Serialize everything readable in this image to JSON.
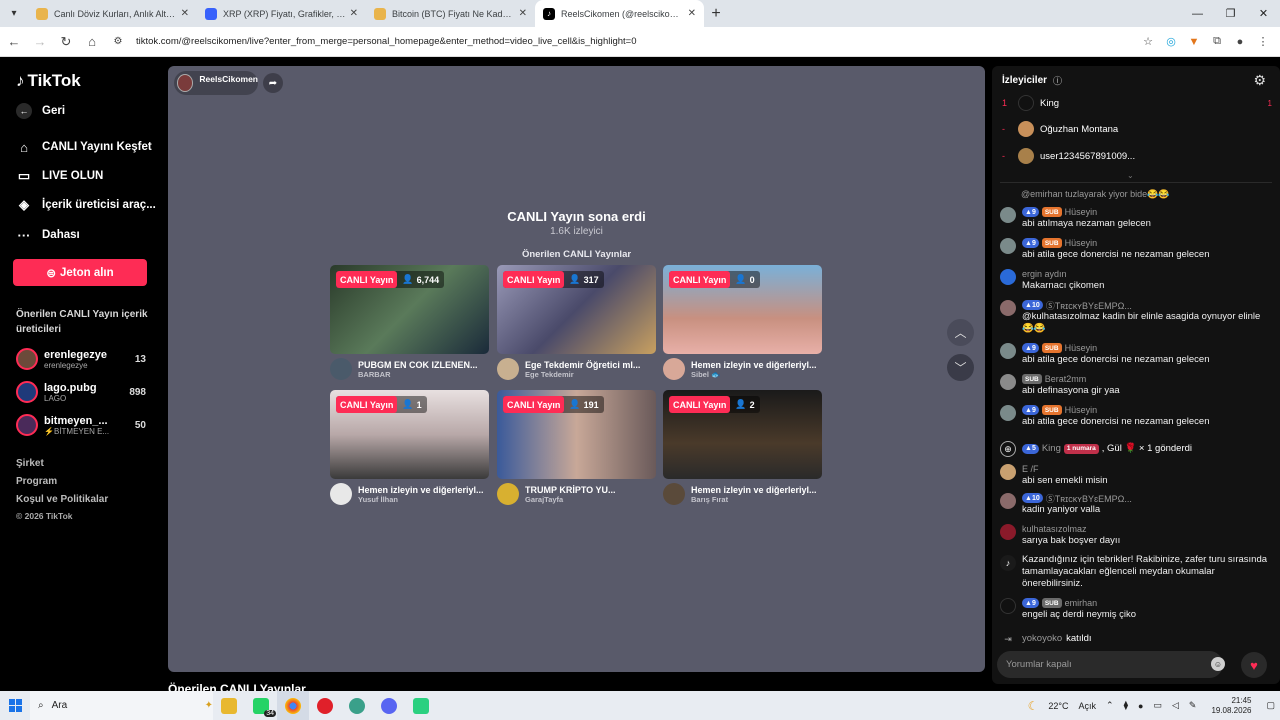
{
  "browser": {
    "tabs": [
      {
        "title": "Canlı Döviz Kurları, Anlık Altın F",
        "icon_color": "#e9b44c"
      },
      {
        "title": "XRP (XRP) Fiyatı, Grafikler, Piyas",
        "icon_color": "#3861fb"
      },
      {
        "title": "Bitcoin (BTC) Fiyatı Ne Kadar? G",
        "icon_color": "#e9b44c"
      },
      {
        "title": "ReelsCikomen (@reelscikomen)",
        "icon_color": "#000000"
      }
    ],
    "url": "tiktok.com/@reelscikomen/live?enter_from_merge=personal_homepage&enter_method=video_live_cell&is_highlight=0"
  },
  "sidebar": {
    "logo": "TikTok",
    "back": "Geri",
    "nav": [
      {
        "label": "CANLI Yayını Keşfet",
        "icon": "home-icon"
      },
      {
        "label": "LIVE OLUN",
        "icon": "camera-icon"
      },
      {
        "label": "İçerik üreticisi araç...",
        "icon": "lightbulb-icon"
      },
      {
        "label": "Dahası",
        "icon": "more-icon"
      }
    ],
    "jeton": "Jeton alın",
    "recommended_title": "Önerilen CANLI Yayın içerik üreticileri",
    "creators": [
      {
        "name": "erenlegezye",
        "sub": "erenlegezye",
        "count": "13",
        "color": "#6b4a3a"
      },
      {
        "name": "lago.pubg",
        "sub": "LAGO",
        "count": "898",
        "color": "#1f3a7a"
      },
      {
        "name": "bitmeyen_...",
        "sub": "⚡BİTMEYEN E...",
        "count": "50",
        "color": "#4a2a5a"
      }
    ],
    "footer": [
      "Şirket",
      "Program",
      "Koşul ve Politikalar"
    ],
    "copyright": "© 2026 TikTok"
  },
  "stage": {
    "host": "ReelsCikomen",
    "ended_title": "CANLI Yayın sona erdi",
    "viewers": "1.6K izleyici",
    "recommended": "Önerilen CANLI Yayınlar",
    "live_label": "CANLI Yayın",
    "cards": [
      {
        "count": "6,744",
        "title": "PUBGM EN COK IZLENEN...",
        "user": "BARBAR",
        "bg": "#3a4a3a"
      },
      {
        "count": "317",
        "title": "Ege Tekdemir Öğretici ml...",
        "user": "Ege Tekdemir",
        "bg": "#6a6a8a"
      },
      {
        "count": "0",
        "title": "Hemen izleyin ve diğerleriyl...",
        "user": "Sibel 🐟",
        "bg": "#5a8ab0"
      },
      {
        "count": "1",
        "title": "Hemen izleyin ve diğerleriyl...",
        "user": "Yusuf İlhan",
        "bg": "#b8a8a8"
      },
      {
        "count": "191",
        "title": "TRUMP KRİPTO YU...",
        "user": "GarajTayfa",
        "bg": "#7a6a6a"
      },
      {
        "count": "2",
        "title": "Hemen izleyin ve diğerleriyl...",
        "user": "Barış Fırat",
        "bg": "#2a2a2a"
      }
    ],
    "below_heading": "Önerilen CANLI Yayınlar"
  },
  "chat": {
    "header": "İzleyiciler",
    "ranking": [
      {
        "rank": "1",
        "name": "King",
        "score": "1"
      },
      {
        "rank": "-",
        "name": "Oğuzhan Montana",
        "score": ""
      },
      {
        "rank": "-",
        "name": "user1234567891009...",
        "score": ""
      }
    ],
    "messages": [
      {
        "user": "@emirhan tuzlayarak yiyor bide😂😂",
        "level": "",
        "sub": "",
        "text": ""
      },
      {
        "user": "Hüseyin",
        "level": "9",
        "sub": "SUB",
        "text": "abi atılmaya nezaman gelecen"
      },
      {
        "user": "Hüseyin",
        "level": "9",
        "sub": "SUB",
        "text": "abi atila gece donercisi ne nezaman gelecen"
      },
      {
        "user": "ergin aydın",
        "level": "",
        "sub": "",
        "text": "Makarnacı çikomen"
      },
      {
        "user": "ⓈTʀɪᴄᴋʏBYɛEMPΩ...",
        "level": "10",
        "sub": "",
        "text": "@kulhatasızolmaz kadin bir elinle asagida oynuyor elinle😂😂"
      },
      {
        "user": "Hüseyin",
        "level": "9",
        "sub": "SUB",
        "text": "abi atila gece donercisi ne nezaman gelecen"
      },
      {
        "user": "Berat2mm",
        "level": "",
        "sub": "SUB",
        "text": "abi definasyona gir yaa"
      },
      {
        "user": "Hüseyin",
        "level": "9",
        "sub": "SUB",
        "text": "abi atila gece donercisi ne nezaman gelecen"
      },
      {
        "user": "E /F",
        "level": "",
        "sub": "",
        "text": "abi sen emekli misin"
      },
      {
        "user": "ⓈTʀɪᴄᴋʏBYɛEMPΩ...",
        "level": "10",
        "sub": "",
        "text": "kadin yaniyor valla"
      },
      {
        "user": "kulhatasızolmaz",
        "level": "",
        "sub": "",
        "text": "sarıya bak boşver dayıı"
      },
      {
        "user": "",
        "level": "",
        "sub": "",
        "text": "Kazandığınız için tebrikler! Rakibinize, zafer turu sırasında tamamlayacakları eğlenceli meydan okumalar önerebilirsiniz."
      },
      {
        "user": "emirhan",
        "level": "9",
        "sub": "SUB",
        "text": "engeli aç derdi neymiş çiko"
      }
    ],
    "gift": {
      "level": "5",
      "user": "King",
      "tag": "1 numara",
      "text": ", Gül 🌹 × 1 gönderdi"
    },
    "joined": {
      "user": "yokoyoko",
      "text": "katıldı"
    },
    "input_placeholder": "Yorumlar kapalı"
  },
  "taskbar": {
    "search": "Ara",
    "weather": "22°C",
    "weather_text": "Açık",
    "time": "21:45",
    "date": "19.08.2026",
    "badge": "34"
  }
}
